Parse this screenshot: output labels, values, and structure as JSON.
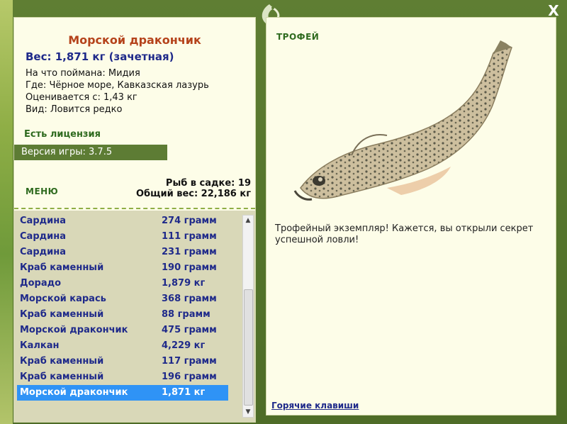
{
  "window": {
    "close_label": "X"
  },
  "fish": {
    "title": "Морской дракончик",
    "weight_line": "Вес: 1,871 кг (зачетная)"
  },
  "info": [
    {
      "label": "На что поймана: ",
      "value": "Мидия"
    },
    {
      "label": "Где: ",
      "value": "Чёрное море, Кавказская лазурь"
    },
    {
      "label": "Оценивается с: ",
      "value": "1,43 кг"
    },
    {
      "label": "Вид: ",
      "value": "Ловится редко"
    }
  ],
  "license": "Есть лицензия",
  "version": "Версия игры: 3.7.5",
  "menu_label": "МЕНЮ",
  "stats": {
    "cage_line": "Рыб в садке: 19",
    "total_line": "Общий вес: 22,186 кг"
  },
  "catch": [
    {
      "name": "Сардина",
      "weight": "274 грамм"
    },
    {
      "name": "Сардина",
      "weight": "111 грамм"
    },
    {
      "name": "Сардина",
      "weight": "231 грамм"
    },
    {
      "name": "Краб каменный",
      "weight": "190 грамм"
    },
    {
      "name": "Дорадо",
      "weight": "1,879 кг"
    },
    {
      "name": "Морской карась",
      "weight": "368 грамм"
    },
    {
      "name": "Краб каменный",
      "weight": "88 грамм"
    },
    {
      "name": "Морской дракончик",
      "weight": "475 грамм"
    },
    {
      "name": "Калкан",
      "weight": "4,229 кг"
    },
    {
      "name": "Краб каменный",
      "weight": "117 грамм"
    },
    {
      "name": "Краб каменный",
      "weight": "196 грамм"
    },
    {
      "name": "Морской дракончик",
      "weight": "1,871 кг"
    }
  ],
  "trophy": {
    "label": "ТРОФЕЙ",
    "text": "Трофейный экземпляр! Кажется, вы открыли секрет успешной ловли!"
  },
  "hotkeys": "Горячие клавиши",
  "colors": {
    "frame": "#5f7e33",
    "panel": "#fdfde8",
    "title": "#b5431b",
    "accent_text": "#1f2a8a",
    "selection": "#2f93f6",
    "green_label": "#2e6a1e"
  },
  "icons": {
    "logo": "dragon-logo-icon",
    "close": "close-icon"
  }
}
